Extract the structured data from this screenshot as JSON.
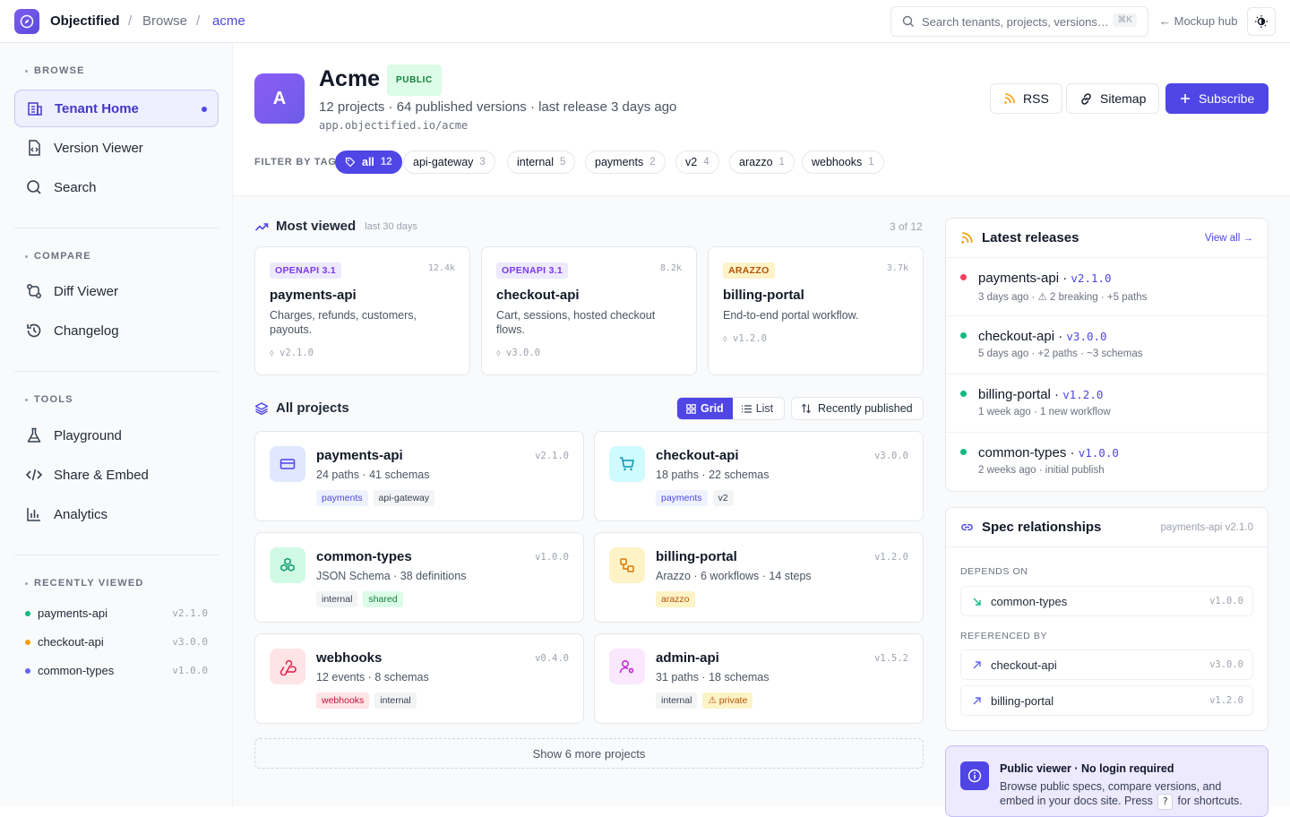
{
  "topbar": {
    "brand": "Objectified",
    "crumb_browse": "Browse",
    "crumb_tenant": "acme",
    "search_placeholder": "Search tenants, projects, versions…",
    "search_kbd": "⌘K",
    "mockup_hub": "← Mockup hub"
  },
  "sidebar": {
    "browse_title": "BROWSE",
    "browse_items": [
      {
        "label": "Tenant Home",
        "icon": "building-icon"
      },
      {
        "label": "Version Viewer",
        "icon": "file-code-icon"
      },
      {
        "label": "Search",
        "icon": "search-icon"
      }
    ],
    "compare_title": "COMPARE",
    "compare_items": [
      {
        "label": "Diff Viewer",
        "icon": "diff-icon"
      },
      {
        "label": "Changelog",
        "icon": "history-icon"
      }
    ],
    "tools_title": "TOOLS",
    "tools_items": [
      {
        "label": "Playground",
        "icon": "flask-icon"
      },
      {
        "label": "Share & Embed",
        "icon": "code-icon"
      },
      {
        "label": "Analytics",
        "icon": "bar-chart-icon"
      }
    ],
    "recent_title": "RECENTLY VIEWED",
    "recent_items": [
      {
        "name": "payments-api",
        "version": "v2.1.0",
        "color": "#10b981"
      },
      {
        "name": "checkout-api",
        "version": "v3.0.0",
        "color": "#f59e0b"
      },
      {
        "name": "common-types",
        "version": "v1.0.0",
        "color": "#6366f1"
      }
    ]
  },
  "header": {
    "avatar_letter": "A",
    "tenant_name": "Acme",
    "badge": "PUBLIC",
    "meta": "12 projects · 64 published versions · last release 3 days ago",
    "url": "app.objectified.io/acme",
    "rss_label": "RSS",
    "sitemap_label": "Sitemap",
    "subscribe_label": "Subscribe"
  },
  "filter": {
    "label": "FILTER BY TAG",
    "chips": [
      {
        "label": "all",
        "count": "12"
      },
      {
        "label": "api-gateway",
        "count": "3"
      },
      {
        "label": "internal",
        "count": "5"
      },
      {
        "label": "payments",
        "count": "2"
      },
      {
        "label": "v2",
        "count": "4"
      },
      {
        "label": "arazzo",
        "count": "1"
      },
      {
        "label": "webhooks",
        "count": "1"
      }
    ]
  },
  "most_viewed": {
    "title": "Most viewed",
    "subtitle": "last 30 days",
    "count": "3 of 12",
    "cards": [
      {
        "badge": "OPENAPI 3.1",
        "views": "12.4k",
        "name": "payments-api",
        "desc": "Charges, refunds, customers, payouts.",
        "version": "v2.1.0"
      },
      {
        "badge": "OPENAPI 3.1",
        "views": "8.2k",
        "name": "checkout-api",
        "desc": "Cart, sessions, hosted checkout flows.",
        "version": "v3.0.0"
      },
      {
        "badge": "ARAZZO",
        "views": "3.7k",
        "name": "billing-portal",
        "desc": "End-to-end portal workflow.",
        "version": "v1.2.0"
      }
    ]
  },
  "projects": {
    "title": "All projects",
    "grid_label": "Grid",
    "list_label": "List",
    "sort_label": "Recently published",
    "items": [
      {
        "name": "payments-api",
        "version": "v2.1.0",
        "stats": "24 paths · 41 schemas",
        "tags": [
          "payments",
          "api-gateway"
        ]
      },
      {
        "name": "checkout-api",
        "version": "v3.0.0",
        "stats": "18 paths · 22 schemas",
        "tags": [
          "payments",
          "v2"
        ]
      },
      {
        "name": "common-types",
        "version": "v1.0.0",
        "stats": "JSON Schema · 38 definitions",
        "tags": [
          "internal",
          "shared"
        ]
      },
      {
        "name": "billing-portal",
        "version": "v1.2.0",
        "stats": "Arazzo · 6 workflows · 14 steps",
        "tags": [
          "arazzo"
        ]
      },
      {
        "name": "webhooks",
        "version": "v0.4.0",
        "stats": "12 events · 8 schemas",
        "tags": [
          "webhooks",
          "internal"
        ]
      },
      {
        "name": "admin-api",
        "version": "v1.5.2",
        "stats": "31 paths · 18 schemas",
        "tags": [
          "internal",
          "⚠ private"
        ]
      }
    ],
    "show_more": "Show 6 more projects"
  },
  "latest_releases": {
    "title": "Latest releases",
    "view_all": "View all →",
    "items": [
      {
        "name": "payments-api",
        "version": "v2.1.0",
        "sub": "3 days ago · ⚠ 2 breaking · +5 paths",
        "color": "#f43f5e"
      },
      {
        "name": "checkout-api",
        "version": "v3.0.0",
        "sub": "5 days ago · +2 paths · ~3 schemas",
        "color": "#10b981"
      },
      {
        "name": "billing-portal",
        "version": "v1.2.0",
        "sub": "1 week ago · 1 new workflow",
        "color": "#10b981"
      },
      {
        "name": "common-types",
        "version": "v1.0.0",
        "sub": "2 weeks ago · initial publish",
        "color": "#10b981"
      }
    ]
  },
  "relationships": {
    "title": "Spec relationships",
    "context": "payments-api v2.1.0",
    "depends_label": "DEPENDS ON",
    "depends": [
      {
        "name": "common-types",
        "version": "v1.0.0"
      }
    ],
    "referenced_label": "REFERENCED BY",
    "referenced": [
      {
        "name": "checkout-api",
        "version": "v3.0.0"
      },
      {
        "name": "billing-portal",
        "version": "v1.2.0"
      }
    ]
  },
  "info": {
    "title": "Public viewer · No login required",
    "desc_a": "Browse public specs, compare versions, and embed in your docs site. Press",
    "key": "?",
    "desc_b": "for shortcuts."
  }
}
